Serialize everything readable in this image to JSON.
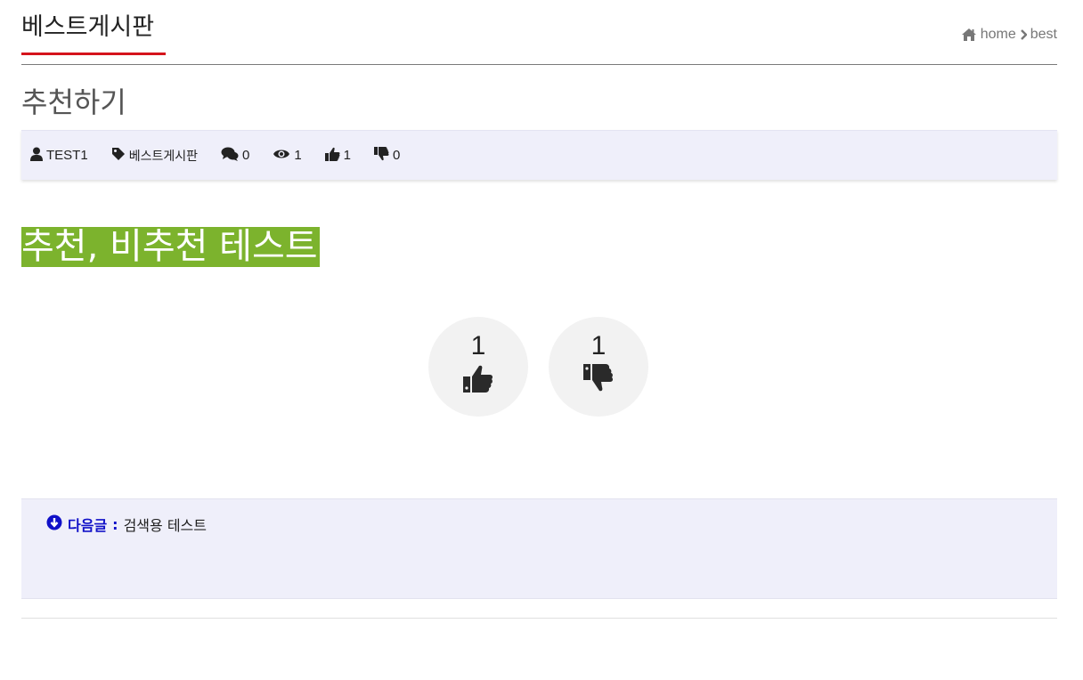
{
  "header": {
    "board_title": "베스트게시판",
    "breadcrumb": {
      "home": "home",
      "current": "best"
    }
  },
  "post": {
    "title": "추천하기",
    "meta": {
      "author": "TEST1",
      "category": "베스트게시판",
      "comments": "0",
      "views": "1",
      "likes": "1",
      "dislikes": "0"
    },
    "content_heading": "추천, 비추천 테스트"
  },
  "votes": {
    "recommend_count": "1",
    "not_recommend_count": "1"
  },
  "next_post": {
    "label": "다음글",
    "separator": ":",
    "title": "검색용 테스트"
  },
  "colors": {
    "accent_red": "#d5141c",
    "meta_bg": "#efeffa",
    "heading_bg": "#7cb32d",
    "next_label": "#1010c8"
  }
}
